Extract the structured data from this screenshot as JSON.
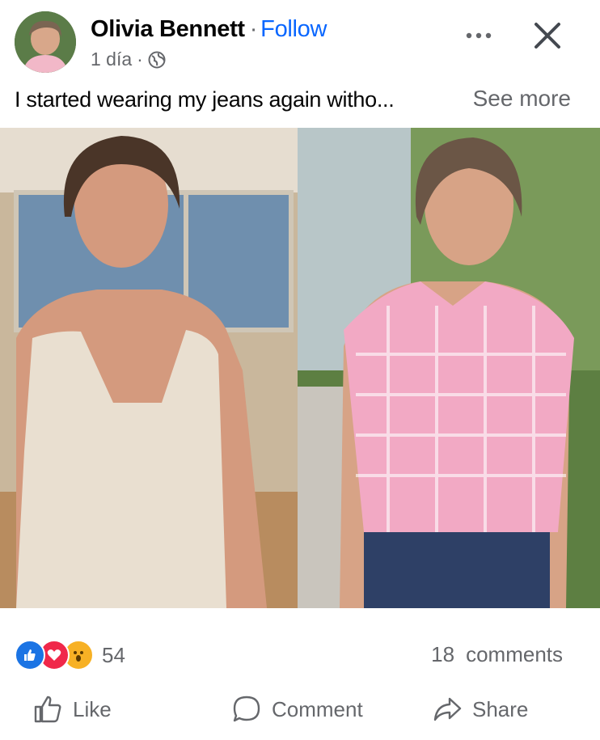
{
  "post": {
    "author": "Olivia Bennett",
    "separator": "·",
    "follow_label": "Follow",
    "time": "1 día",
    "time_sep": "·",
    "caption": "I started wearing my jeans again witho...",
    "see_more": "See more"
  },
  "icons": {
    "more": "more-dots-icon",
    "close": "close-icon",
    "audience": "globe-icon"
  },
  "photo": {
    "description_icons": [
      "before-photo",
      "after-photo"
    ]
  },
  "engagement": {
    "reaction_icons": [
      "like-reaction-icon",
      "love-reaction-icon",
      "wow-reaction-icon"
    ],
    "reaction_count": "54",
    "comment_count": "18",
    "comment_label": "comments"
  },
  "actions": {
    "like": "Like",
    "comment": "Comment",
    "share": "Share"
  },
  "colors": {
    "link": "#0866ff",
    "secondary_text": "#65676b",
    "like": "#1b74e4",
    "love": "#f0284a",
    "wow": "#f7b125"
  }
}
